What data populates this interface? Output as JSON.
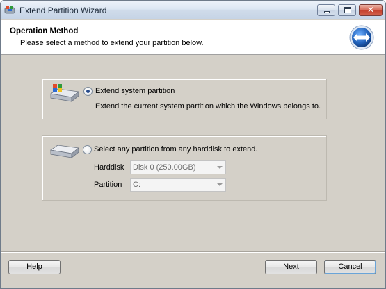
{
  "window": {
    "title": "Extend Partition Wizard",
    "close_glyph": "✕"
  },
  "header": {
    "title": "Operation Method",
    "subtitle": "Please select a method to extend your partition below."
  },
  "options": {
    "extend_system": {
      "label": "Extend system partition",
      "description": "Extend the current system partition which the Windows belongs to.",
      "selected": true
    },
    "any_partition": {
      "label": "Select any partition from any harddisk to extend.",
      "selected": false,
      "harddisk_label": "Harddisk",
      "harddisk_value": "Disk 0 (250.00GB)",
      "partition_label": "Partition",
      "partition_value": "C:"
    }
  },
  "footer": {
    "help_label": "Help",
    "next_label": "Next",
    "cancel_label": "Cancel"
  },
  "icons": {
    "app": "partition-wizard-icon",
    "header": "extend-arrows-icon",
    "disk_system": "windows-disk-icon",
    "disk_any": "harddisk-icon"
  },
  "colors": {
    "accent": "#1f5fb8",
    "dialog_background": "#d4d0c8",
    "radio_dot": "#264a8c"
  }
}
